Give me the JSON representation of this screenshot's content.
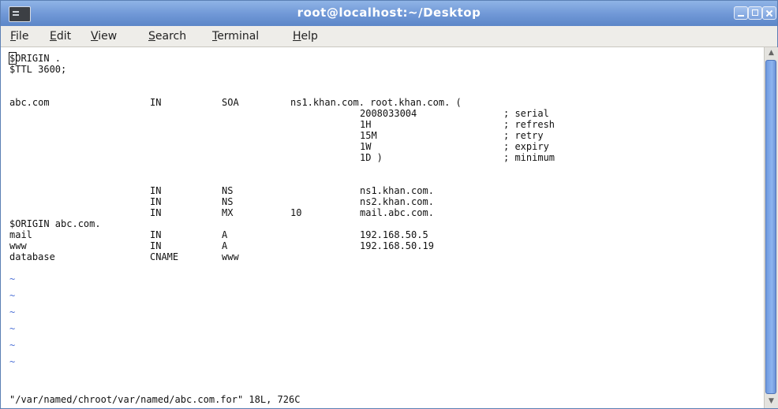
{
  "window": {
    "title": "root@localhost:~/Desktop",
    "icon": "terminal-icon",
    "controls": [
      "minimize-icon",
      "maximize-icon",
      "close-icon"
    ]
  },
  "menu": {
    "items": [
      {
        "key": "F",
        "rest": "ile"
      },
      {
        "key": "E",
        "rest": "dit"
      },
      {
        "key": "V",
        "rest": "iew"
      },
      {
        "key": "S",
        "rest": "earch"
      },
      {
        "key": "T",
        "rest": "erminal"
      },
      {
        "key": "H",
        "rest": "elp"
      }
    ]
  },
  "zone": {
    "header1": "$ORIGIN .",
    "header2": "$TTL 3600;",
    "soa": {
      "name": "abc.com",
      "class": "IN",
      "type": "SOA",
      "rdata": "ns1.khan.com. root.khan.com. (",
      "fields": [
        {
          "value": "2008033004",
          "comment": "; serial"
        },
        {
          "value": "1H",
          "comment": "; refresh"
        },
        {
          "value": "15M",
          "comment": "; retry"
        },
        {
          "value": "1W",
          "comment": "; expiry"
        },
        {
          "value": "1D )",
          "comment": "; minimum"
        }
      ]
    },
    "records1": [
      {
        "class": "IN",
        "type": "NS",
        "pref": "",
        "data": "ns1.khan.com."
      },
      {
        "class": "IN",
        "type": "NS",
        "pref": "",
        "data": "ns2.khan.com."
      },
      {
        "class": "IN",
        "type": "MX",
        "pref": "10",
        "data": "mail.abc.com."
      }
    ],
    "origin2": "$ORIGIN abc.com.",
    "records2": [
      {
        "name": "mail",
        "class": "IN",
        "type": "A",
        "data": "192.168.50.5"
      },
      {
        "name": "www",
        "class": "IN",
        "type": "A",
        "data": "192.168.50.19"
      },
      {
        "name": "database",
        "class": "CNAME",
        "type": "www",
        "data": ""
      }
    ],
    "tildes": [
      "~",
      "~",
      "~",
      "~",
      "~",
      "~"
    ]
  },
  "status_line": "\"/var/named/chroot/var/named/abc.com.for\" 18L, 726C"
}
